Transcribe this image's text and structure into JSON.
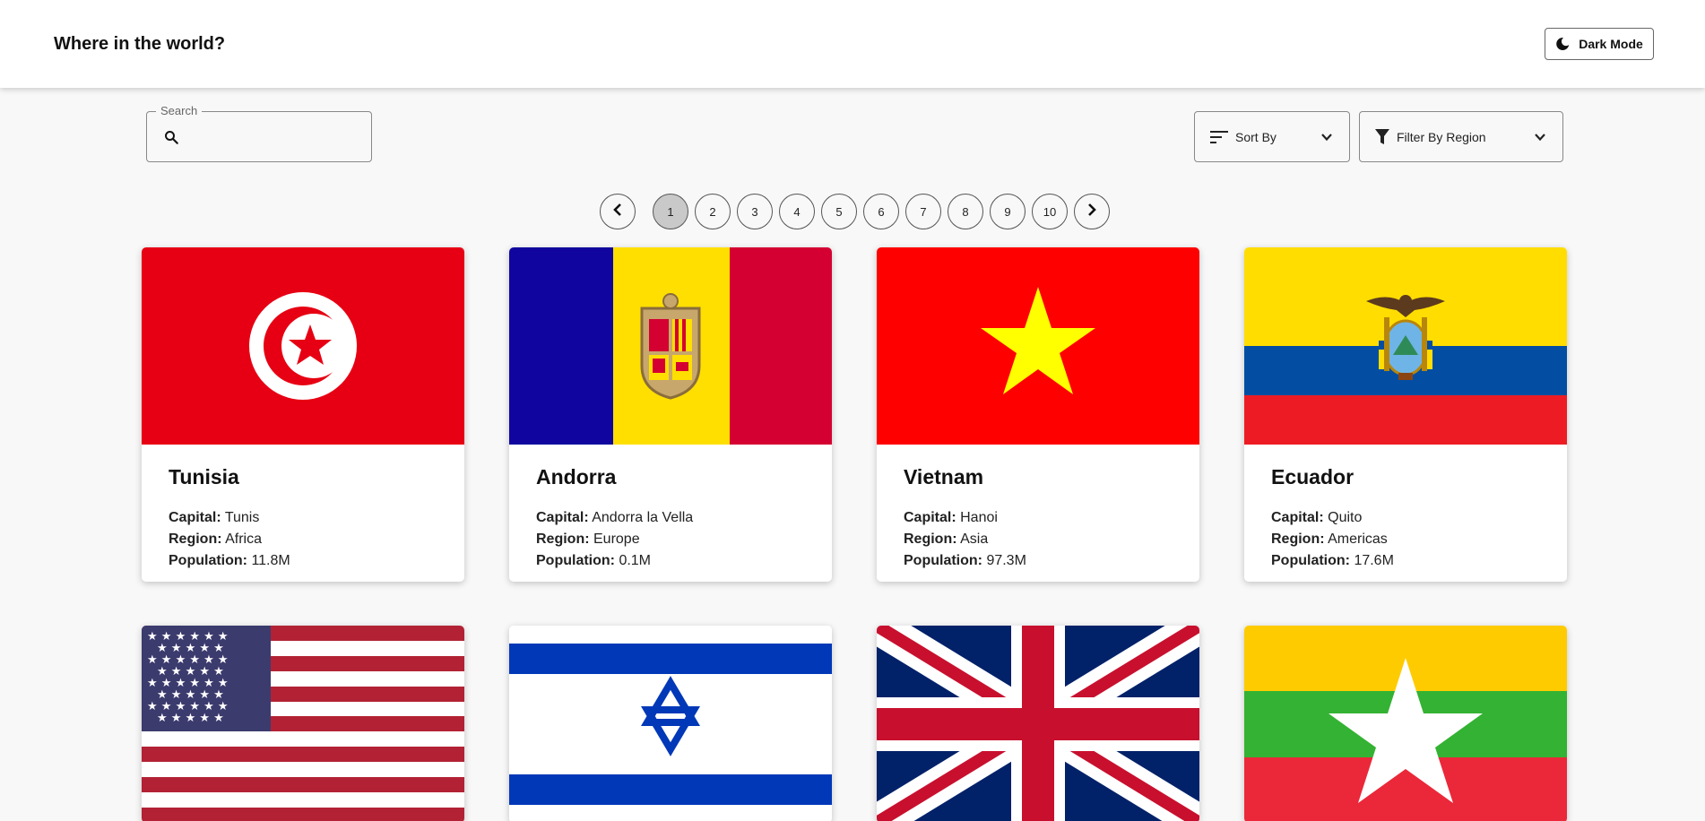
{
  "header": {
    "title": "Where in the world?",
    "dark_mode_label": "Dark Mode"
  },
  "search": {
    "label": "Search",
    "value": "",
    "placeholder": ""
  },
  "sort": {
    "label": "Sort By"
  },
  "filter": {
    "label": "Filter By Region"
  },
  "pagination": {
    "pages": [
      "1",
      "2",
      "3",
      "4",
      "5",
      "6",
      "7",
      "8",
      "9",
      "10"
    ],
    "current": "1"
  },
  "labels": {
    "capital": "Capital:",
    "region": "Region:",
    "population": "Population:"
  },
  "countries": [
    {
      "name": "Tunisia",
      "capital": "Tunis",
      "region": "Africa",
      "population": "11.8M",
      "flag": "tunisia-flag"
    },
    {
      "name": "Andorra",
      "capital": "Andorra la Vella",
      "region": "Europe",
      "population": "0.1M",
      "flag": "andorra-flag"
    },
    {
      "name": "Vietnam",
      "capital": "Hanoi",
      "region": "Asia",
      "population": "97.3M",
      "flag": "vietnam-flag"
    },
    {
      "name": "Ecuador",
      "capital": "Quito",
      "region": "Americas",
      "population": "17.6M",
      "flag": "ecuador-flag"
    },
    {
      "flag": "usa-flag"
    },
    {
      "flag": "israel-flag"
    },
    {
      "flag": "uk-flag"
    },
    {
      "flag": "myanmar-flag"
    }
  ],
  "icons": {
    "dark_mode": "moon-icon",
    "search": "search-icon",
    "sort": "sort-lines-icon",
    "filter": "funnel-icon",
    "dropdown": "chevron-down-icon",
    "prev": "chevron-left-icon",
    "next": "chevron-right-icon"
  }
}
